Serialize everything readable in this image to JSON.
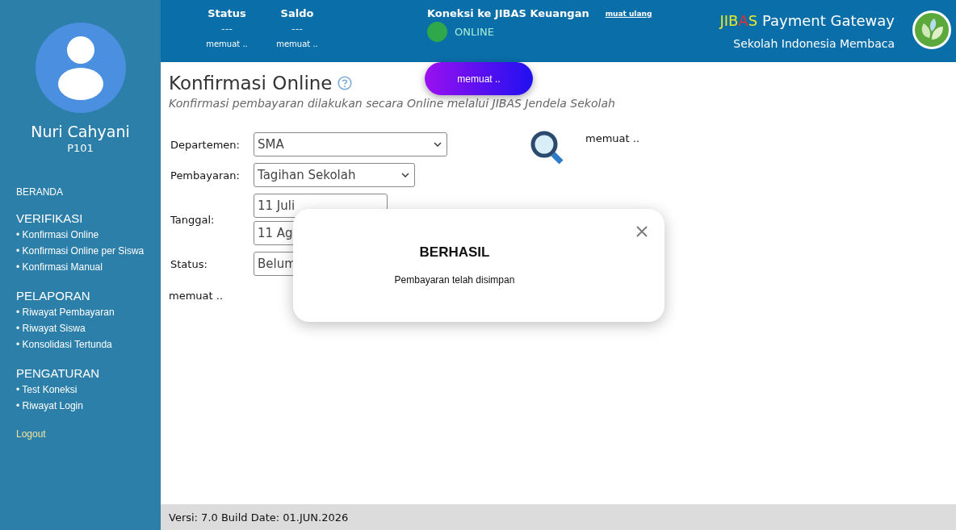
{
  "header": {
    "stats": [
      {
        "label": "Status",
        "value": "---",
        "note": "memuat .."
      },
      {
        "label": "Saldo",
        "value": "---",
        "note": "memuat .."
      }
    ],
    "connection": {
      "label": "Koneksi ke JIBAS Keuangan",
      "status": "ONLINE",
      "online": true,
      "reload": "muat ulang"
    },
    "brand": {
      "logo": "JIBAS",
      "title": "Payment Gateway",
      "school": "Sekolah Indonesia Membaca"
    }
  },
  "sidebar": {
    "user": {
      "name": "Nuri Cahyani",
      "id": "P101"
    },
    "home": "BERANDA",
    "sections": [
      {
        "title": "VERIFIKASI",
        "items": [
          "• Konfirmasi Online",
          "• Konfirmasi Online per Siswa",
          "• Konfirmasi Manual"
        ]
      },
      {
        "title": "PELAPORAN",
        "items": [
          "• Riwayat Pembayaran",
          "• Riwayat Siswa",
          "• Konsolidasi Tertunda"
        ]
      },
      {
        "title": "PENGATURAN",
        "items": [
          "• Test Koneksi",
          "• Riwayat Login"
        ]
      }
    ],
    "logout": "Logout"
  },
  "loading_toast": "memuat ..",
  "page": {
    "title": "Konfirmasi Online",
    "subtitle": "Konfirmasi pembayaran dilakukan secara Online melalui JIBAS Jendela Sekolah",
    "form": [
      {
        "label": "Departemen:",
        "kind": "select",
        "value": "SMA"
      },
      {
        "label": "Pembayaran:",
        "kind": "select",
        "value": "Tagihan Sekolah"
      },
      {
        "label": "Tanggal:",
        "kind": "dates",
        "values": [
          "11 Juli",
          "11 Ag"
        ]
      },
      {
        "label": "Status:",
        "kind": "text",
        "value": "Belum"
      }
    ],
    "search_status": "memuat ..",
    "list_status": "memuat .."
  },
  "dialog": {
    "title": "BERHASIL",
    "message": "Pembayaran telah disimpan"
  },
  "footer": "Versi: 7.0 Build Date: 01.JUN.2026"
}
